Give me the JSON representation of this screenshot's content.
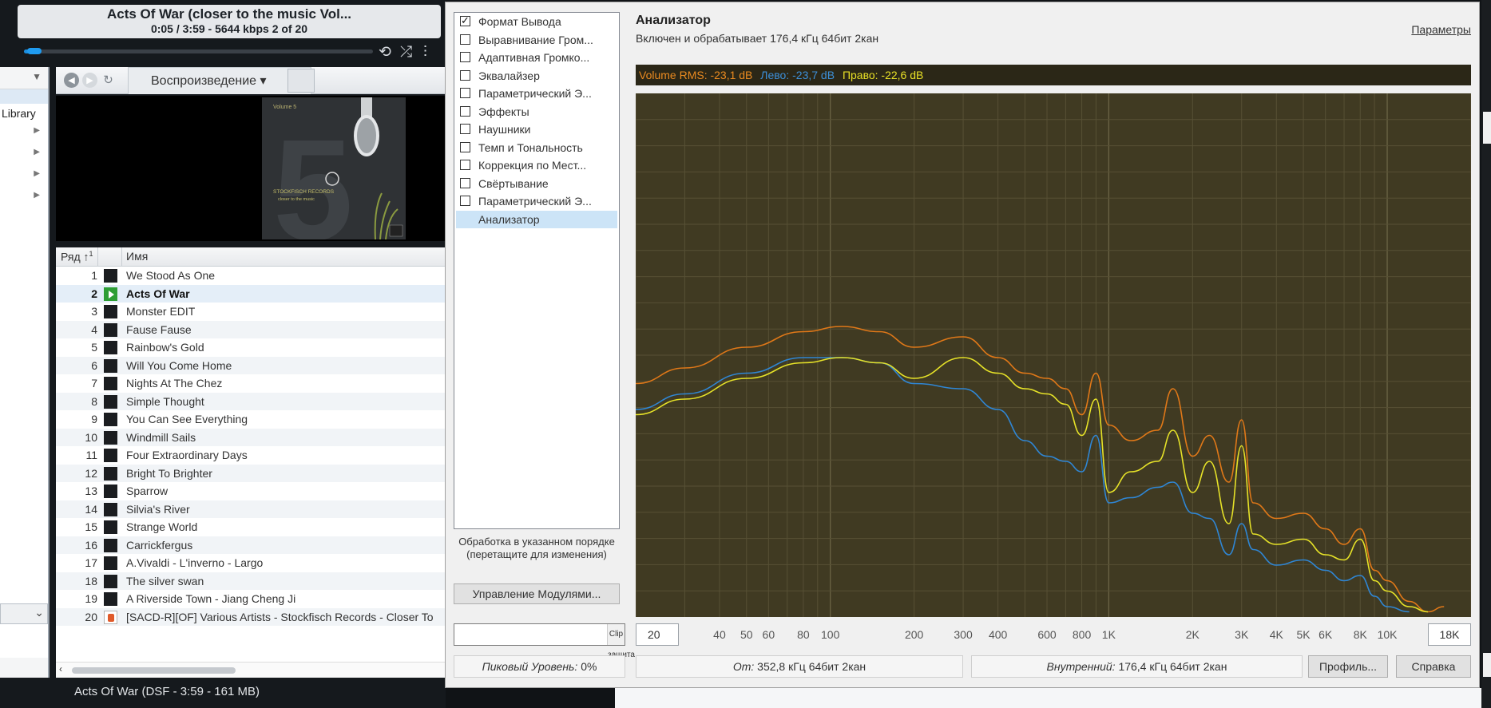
{
  "player": {
    "track_title": "Acts Of War (closer to the music Vol...",
    "track_info": "0:05 / 3:59 - 5644 kbps   2 of 20",
    "progress": 0.02,
    "controls": [
      "repeat-icon",
      "shuffle-icon",
      "equalizer-icon"
    ]
  },
  "tree": {
    "library_label": "Library"
  },
  "browser": {
    "playback_tab_label": "Воспроизведение ▾"
  },
  "cover": {
    "volume_label": "Volume 5",
    "number": "5",
    "label_line1": "STOCKFISCH RECORDS",
    "label_line2": "closer to the music"
  },
  "playlist": {
    "col_num": "Ряд",
    "col_name": "Имя",
    "playing_index": 2,
    "rows": [
      {
        "num": "1",
        "name": "We Stood As One"
      },
      {
        "num": "2",
        "name": "Acts Of War"
      },
      {
        "num": "3",
        "name": "Monster EDIT"
      },
      {
        "num": "4",
        "name": "Fause Fause"
      },
      {
        "num": "5",
        "name": "Rainbow's Gold"
      },
      {
        "num": "6",
        "name": "Will You Come Home"
      },
      {
        "num": "7",
        "name": "Nights At The Chez"
      },
      {
        "num": "8",
        "name": "Simple Thought"
      },
      {
        "num": "9",
        "name": "You Can See Everything"
      },
      {
        "num": "10",
        "name": "Windmill Sails"
      },
      {
        "num": "11",
        "name": "Four Extraordinary Days"
      },
      {
        "num": "12",
        "name": "Bright To Brighter"
      },
      {
        "num": "13",
        "name": "Sparrow"
      },
      {
        "num": "14",
        "name": "Silvia's River"
      },
      {
        "num": "15",
        "name": "Strange World"
      },
      {
        "num": "16",
        "name": "Carrickfergus"
      },
      {
        "num": "17",
        "name": "A.Vivaldi - L'inverno - Largo"
      },
      {
        "num": "18",
        "name": "The silver swan"
      },
      {
        "num": "19",
        "name": "A Riverside Town - Jiang Cheng Ji"
      },
      {
        "num": "20",
        "name": "[SACD-R][OF] Various Artists - Stockfisch Records - Closer To"
      }
    ]
  },
  "status_line": "Acts Of War (DSF - 3:59 - 161 MB)",
  "dsp": {
    "modules": [
      {
        "label": "Формат Вывода",
        "checked": true
      },
      {
        "label": "Выравнивание Гром...",
        "checked": false
      },
      {
        "label": "Адаптивная Громко...",
        "checked": false
      },
      {
        "label": "Эквалайзер",
        "checked": false
      },
      {
        "label": "Параметрический Э...",
        "checked": false
      },
      {
        "label": "Эффекты",
        "checked": false
      },
      {
        "label": "Наушники",
        "checked": false
      },
      {
        "label": "Темп и Тональность",
        "checked": false
      },
      {
        "label": "Коррекция по Мест...",
        "checked": false
      },
      {
        "label": "Свёртывание",
        "checked": false
      },
      {
        "label": "Параметрический Э...",
        "checked": false
      }
    ],
    "active_module": "Анализатор",
    "order_note": "Обработка в указанном порядке (перетащите для изменения)",
    "manage_button": "Управление Модулями...",
    "clip_select": "Clip защита",
    "peak_label": "Пиковый Уровень:",
    "peak_value": "0%",
    "analyzer_title": "Анализатор",
    "analyzer_status": "Включен и обрабатывает 176,4 кГц 64бит 2кан",
    "params_link": "Параметры",
    "rms_text": "Volume RMS: -23,1 dB",
    "left_text": "Лево: -23,7 dB",
    "right_text": "Право: -22,6 dB",
    "freq_min": "20",
    "freq_max": "18K",
    "from_label": "От:",
    "from_value": "352,8 кГц 64бит 2кан",
    "internal_label": "Внутренний:",
    "internal_value": "176,4 кГц 64бит 2кан",
    "profile_button": "Профиль...",
    "help_button": "Справка"
  },
  "chart_data": {
    "type": "line",
    "xscale": "log",
    "xlim": [
      20,
      20000
    ],
    "ticks": [
      "40",
      "50",
      "60",
      "80",
      "100",
      "200",
      "300",
      "400",
      "600",
      "800",
      "1K",
      "2K",
      "3K",
      "4K",
      "5K",
      "6K",
      "8K",
      "10K"
    ],
    "colors": {
      "rms": "#e07818",
      "left": "#2f86d4",
      "right": "#e6e228",
      "background": "#403a22"
    },
    "ylim": [
      0,
      1
    ],
    "series": [
      {
        "name": "Volume RMS",
        "points": [
          [
            20,
            0.45
          ],
          [
            30,
            0.48
          ],
          [
            50,
            0.52
          ],
          [
            80,
            0.55
          ],
          [
            110,
            0.56
          ],
          [
            150,
            0.55
          ],
          [
            200,
            0.52
          ],
          [
            300,
            0.54
          ],
          [
            400,
            0.5
          ],
          [
            500,
            0.47
          ],
          [
            600,
            0.46
          ],
          [
            700,
            0.44
          ],
          [
            800,
            0.39
          ],
          [
            900,
            0.47
          ],
          [
            1000,
            0.37
          ],
          [
            1200,
            0.34
          ],
          [
            1500,
            0.36
          ],
          [
            1700,
            0.44
          ],
          [
            2000,
            0.31
          ],
          [
            2300,
            0.35
          ],
          [
            2700,
            0.26
          ],
          [
            3000,
            0.38
          ],
          [
            3300,
            0.22
          ],
          [
            4000,
            0.19
          ],
          [
            5000,
            0.2
          ],
          [
            6000,
            0.17
          ],
          [
            7000,
            0.14
          ],
          [
            8000,
            0.17
          ],
          [
            9000,
            0.09
          ],
          [
            10000,
            0.07
          ],
          [
            12000,
            0.03
          ],
          [
            14000,
            0.01
          ],
          [
            16000,
            0.02
          ]
        ]
      },
      {
        "name": "Лево",
        "points": [
          [
            20,
            0.4
          ],
          [
            30,
            0.43
          ],
          [
            50,
            0.47
          ],
          [
            80,
            0.5
          ],
          [
            110,
            0.5
          ],
          [
            150,
            0.49
          ],
          [
            200,
            0.45
          ],
          [
            300,
            0.44
          ],
          [
            400,
            0.4
          ],
          [
            500,
            0.34
          ],
          [
            600,
            0.31
          ],
          [
            700,
            0.3
          ],
          [
            800,
            0.28
          ],
          [
            900,
            0.35
          ],
          [
            1000,
            0.22
          ],
          [
            1200,
            0.23
          ],
          [
            1500,
            0.25
          ],
          [
            1700,
            0.26
          ],
          [
            2000,
            0.2
          ],
          [
            2300,
            0.19
          ],
          [
            2700,
            0.12
          ],
          [
            3000,
            0.18
          ],
          [
            3300,
            0.13
          ],
          [
            4000,
            0.1
          ],
          [
            5000,
            0.11
          ],
          [
            6000,
            0.09
          ],
          [
            7000,
            0.07
          ],
          [
            8000,
            0.08
          ],
          [
            9000,
            0.04
          ],
          [
            10000,
            0.02
          ],
          [
            12000,
            0.01
          ]
        ]
      },
      {
        "name": "Право",
        "points": [
          [
            20,
            0.39
          ],
          [
            30,
            0.42
          ],
          [
            50,
            0.46
          ],
          [
            80,
            0.49
          ],
          [
            110,
            0.5
          ],
          [
            150,
            0.49
          ],
          [
            200,
            0.46
          ],
          [
            300,
            0.5
          ],
          [
            400,
            0.47
          ],
          [
            500,
            0.44
          ],
          [
            600,
            0.43
          ],
          [
            700,
            0.41
          ],
          [
            800,
            0.35
          ],
          [
            900,
            0.42
          ],
          [
            1000,
            0.24
          ],
          [
            1200,
            0.28
          ],
          [
            1500,
            0.3
          ],
          [
            1700,
            0.36
          ],
          [
            2000,
            0.24
          ],
          [
            2300,
            0.3
          ],
          [
            2700,
            0.18
          ],
          [
            3000,
            0.33
          ],
          [
            3300,
            0.16
          ],
          [
            4000,
            0.14
          ],
          [
            5000,
            0.15
          ],
          [
            6000,
            0.12
          ],
          [
            7000,
            0.11
          ],
          [
            8000,
            0.15
          ],
          [
            9000,
            0.07
          ],
          [
            10000,
            0.05
          ],
          [
            12000,
            0.02
          ],
          [
            14000,
            0.01
          ]
        ]
      }
    ]
  }
}
